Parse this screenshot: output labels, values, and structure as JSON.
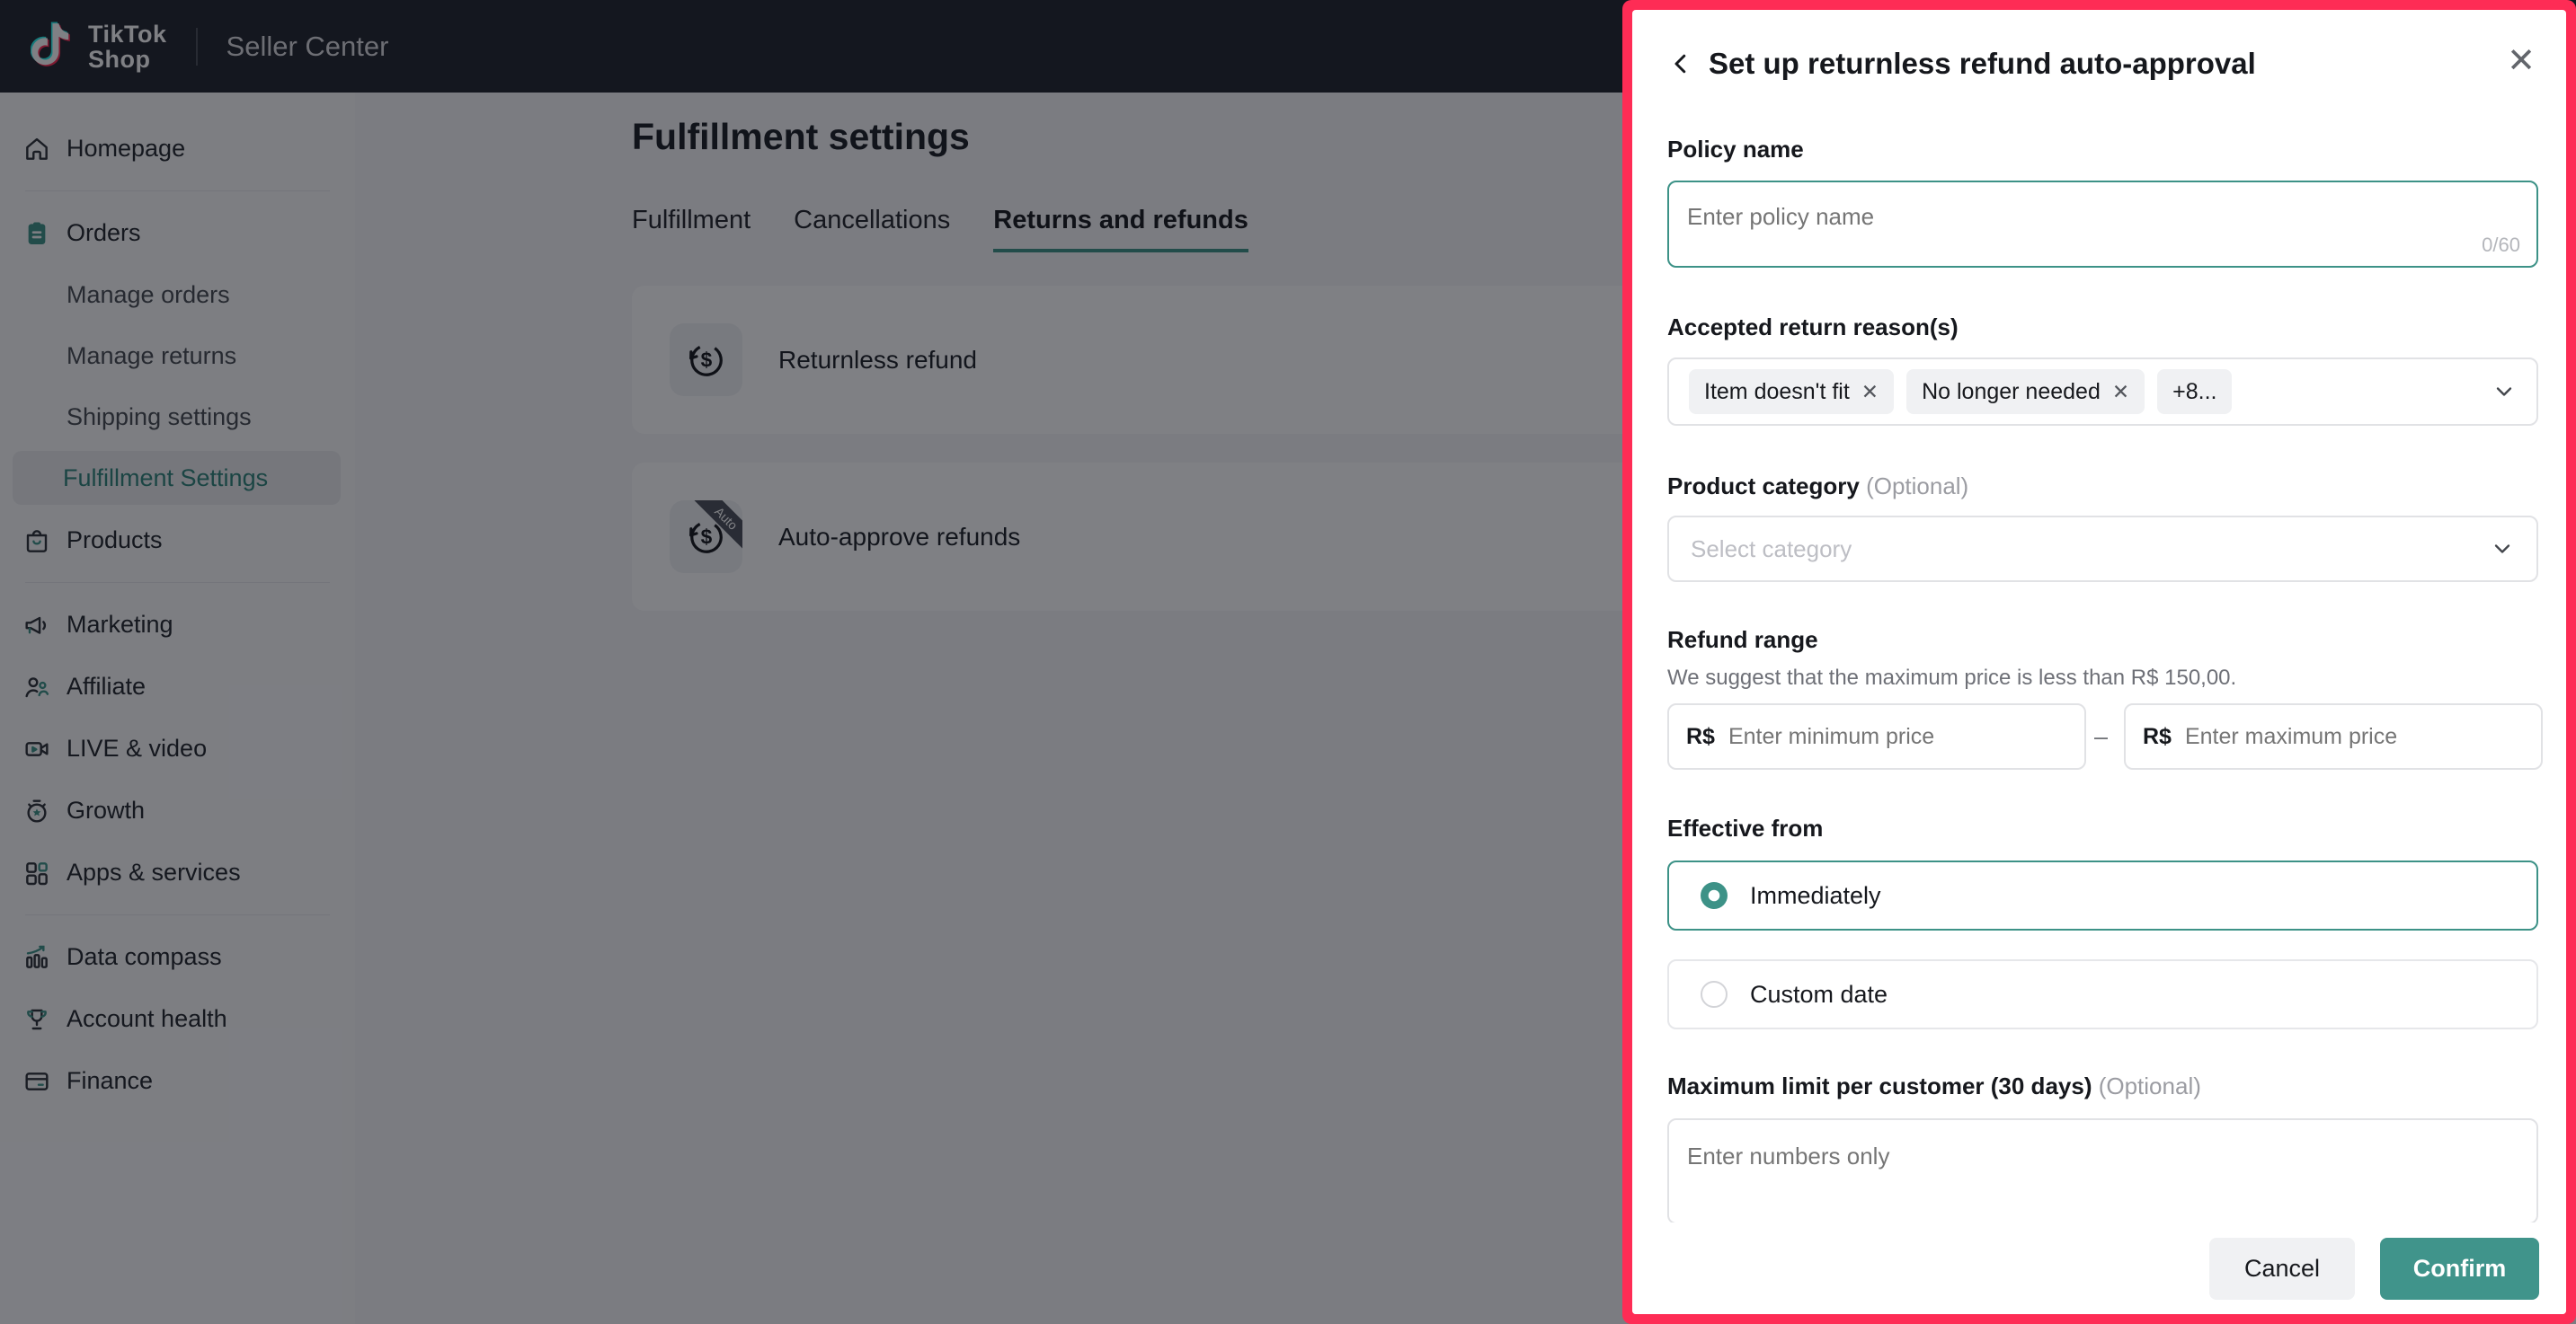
{
  "colors": {
    "accent_teal": "#3d9287",
    "annotation_red": "#fe2c55",
    "header_bg": "#21242c"
  },
  "header": {
    "logo_line1": "TikTok",
    "logo_line2": "Shop",
    "product_name": "Seller Center"
  },
  "sidebar": {
    "items": [
      {
        "label": "Homepage"
      },
      {
        "label": "Orders"
      },
      {
        "label": "Manage orders"
      },
      {
        "label": "Manage returns"
      },
      {
        "label": "Shipping settings"
      },
      {
        "label": "Fulfillment Settings"
      },
      {
        "label": "Products"
      },
      {
        "label": "Marketing"
      },
      {
        "label": "Affiliate"
      },
      {
        "label": "LIVE & video"
      },
      {
        "label": "Growth"
      },
      {
        "label": "Apps & services"
      },
      {
        "label": "Data compass"
      },
      {
        "label": "Account health"
      },
      {
        "label": "Finance"
      }
    ]
  },
  "main": {
    "title": "Fulfillment settings",
    "tabs": [
      {
        "label": "Fulfillment"
      },
      {
        "label": "Cancellations"
      },
      {
        "label": "Returns and refunds"
      }
    ],
    "cards": [
      {
        "title": "Returnless refund"
      },
      {
        "title": "Auto-approve refunds",
        "badge": "Auto"
      }
    ]
  },
  "modal": {
    "title": "Set up returnless refund auto-approval",
    "close_glyph": "✕",
    "policy_name": {
      "label": "Policy name",
      "placeholder": "Enter policy name",
      "counter": "0/60"
    },
    "reasons": {
      "label": "Accepted return reason(s)",
      "chips": [
        {
          "label": "Item doesn't fit",
          "remove_glyph": "✕"
        },
        {
          "label": "No longer needed",
          "remove_glyph": "✕"
        },
        {
          "label": "+8..."
        }
      ]
    },
    "category": {
      "label": "Product category",
      "optional": "(Optional)",
      "placeholder": "Select category"
    },
    "refund_range": {
      "label": "Refund range",
      "helper": "We suggest that the maximum price is less than R$ 150,00.",
      "currency": "R$",
      "separator": "–",
      "min_placeholder": "Enter minimum price",
      "max_placeholder": "Enter maximum price"
    },
    "effective": {
      "label": "Effective from",
      "options": [
        {
          "label": "Immediately"
        },
        {
          "label": "Custom date"
        }
      ]
    },
    "max_limit": {
      "label": "Maximum limit per customer (30 days)",
      "optional": "(Optional)",
      "placeholder": "Enter numbers only"
    },
    "footer": {
      "cancel": "Cancel",
      "confirm": "Confirm"
    }
  }
}
